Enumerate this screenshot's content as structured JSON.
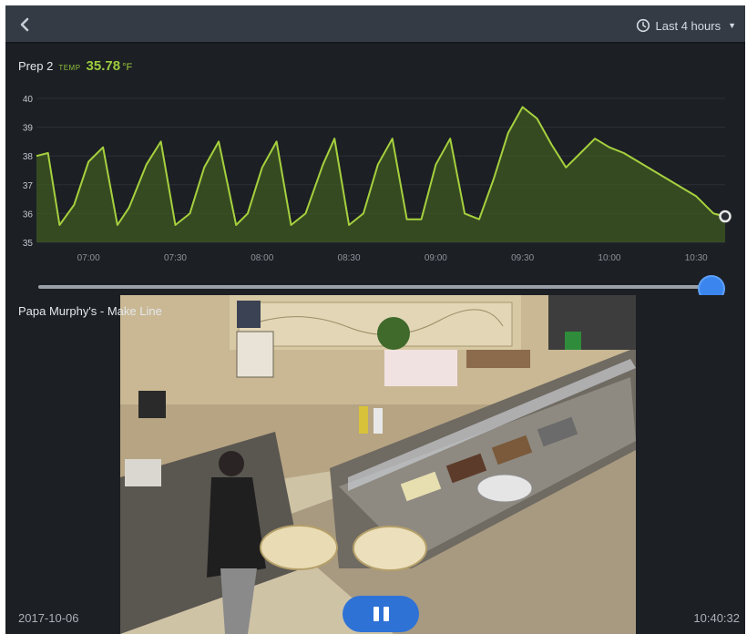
{
  "topbar": {
    "back_icon": "chevron-left-icon",
    "range_icon": "clock-icon",
    "range_label": "Last 4 hours",
    "range_caret_icon": "caret-down-icon"
  },
  "sensor": {
    "name": "Prep 2",
    "metric_label": "TEMP",
    "value": "35.78",
    "unit": "°F"
  },
  "colors": {
    "accent_green": "#9ccc3c",
    "slider_blue": "#3a86ee",
    "pause_blue": "#2f72d6",
    "background": "#1c1f24"
  },
  "chart_data": {
    "type": "area",
    "ylim": [
      35,
      40
    ],
    "yticks": [
      "40",
      "39",
      "38",
      "37",
      "36",
      "35"
    ],
    "xticks": [
      "07:00",
      "07:30",
      "08:00",
      "08:30",
      "09:00",
      "09:30",
      "10:00",
      "10:30"
    ],
    "x": [
      "06:42",
      "06:46",
      "06:50",
      "06:55",
      "07:00",
      "07:05",
      "07:10",
      "07:14",
      "07:20",
      "07:25",
      "07:30",
      "07:35",
      "07:40",
      "07:45",
      "07:51",
      "07:55",
      "08:00",
      "08:05",
      "08:10",
      "08:15",
      "08:21",
      "08:25",
      "08:30",
      "08:35",
      "08:40",
      "08:45",
      "08:50",
      "08:55",
      "09:00",
      "09:05",
      "09:10",
      "09:15",
      "09:20",
      "09:25",
      "09:30",
      "09:35",
      "09:40",
      "09:45",
      "09:50",
      "09:55",
      "10:00",
      "10:05",
      "10:10",
      "10:15",
      "10:20",
      "10:25",
      "10:30",
      "10:36",
      "10:40"
    ],
    "series": [
      {
        "values": [
          38.0,
          38.1,
          35.6,
          36.3,
          37.8,
          38.3,
          35.6,
          36.2,
          37.7,
          38.5,
          35.6,
          36.0,
          37.6,
          38.5,
          35.6,
          36.0,
          37.6,
          38.5,
          35.6,
          36.0,
          37.7,
          38.6,
          35.6,
          36.0,
          37.7,
          38.6,
          35.8,
          35.8,
          37.7,
          38.6,
          36.0,
          35.8,
          37.2,
          38.8,
          39.7,
          39.3,
          38.4,
          37.6,
          38.1,
          38.6,
          38.3,
          38.1,
          37.8,
          37.5,
          37.2,
          36.9,
          36.6,
          36.0,
          35.9
        ]
      }
    ],
    "current_value": 35.78
  },
  "slider": {
    "position": 1.0
  },
  "video": {
    "title": "Papa Murphy's - Make Line",
    "date": "2017-10-06",
    "time": "10:40:32",
    "pause_icon": "pause-icon"
  }
}
